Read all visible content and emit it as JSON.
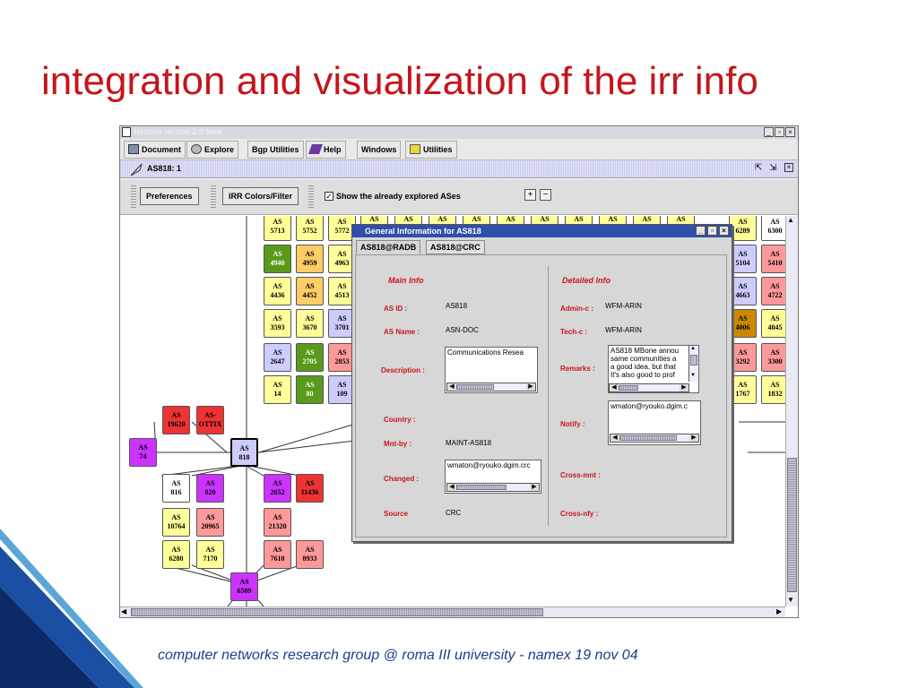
{
  "slide": {
    "title": "integration and visualization of the irr info",
    "footer": "computer networks research group @ roma III university - namex 19 nov 04"
  },
  "window": {
    "title": "Hermes version 2.0 beta"
  },
  "menubar": [
    {
      "label": "Document",
      "icon": "document-icon"
    },
    {
      "label": "Explore",
      "icon": "explore-icon"
    },
    {
      "label": "Bgp Utilities",
      "icon": ""
    },
    {
      "label": "Help",
      "icon": "help-icon"
    },
    {
      "label": "Windows",
      "icon": ""
    },
    {
      "label": "Utilities",
      "icon": "utilities-icon"
    }
  ],
  "frame": {
    "title": "AS818: 1"
  },
  "toolbar": {
    "preferences": "Preferences",
    "irr_colors": "IRR Colors/Filter",
    "show_explored": "Show the already explored ASes",
    "show_explored_checked": true
  },
  "graph": {
    "nodes": [
      {
        "label": "AS 5713",
        "color": "#ffff99"
      },
      {
        "label": "AS 5752",
        "color": "#ffff99"
      },
      {
        "label": "AS 5772",
        "color": "#ffff99"
      },
      {
        "label": "AS 4940",
        "color": "#5a9a1a"
      },
      {
        "label": "AS 4959",
        "color": "#ffcc66"
      },
      {
        "label": "AS 4963",
        "color": "#ffff99"
      },
      {
        "label": "AS 4436",
        "color": "#ffff99"
      },
      {
        "label": "AS 4452",
        "color": "#ffcc66"
      },
      {
        "label": "AS 4513",
        "color": "#ffff99"
      },
      {
        "label": "AS 3593",
        "color": "#ffff99"
      },
      {
        "label": "AS 3670",
        "color": "#ffff99"
      },
      {
        "label": "AS 3701",
        "color": "#ccccff"
      },
      {
        "label": "AS 2647",
        "color": "#ccccff"
      },
      {
        "label": "AS 2705",
        "color": "#5a9a1a"
      },
      {
        "label": "AS 2853",
        "color": "#ff9999"
      },
      {
        "label": "AS 14",
        "color": "#ffff99"
      },
      {
        "label": "AS 80",
        "color": "#5a9a1a"
      },
      {
        "label": "AS 109",
        "color": "#ccccff"
      },
      {
        "label": "AS 19620",
        "color": "#ee3333"
      },
      {
        "label": "AS- OTTIX",
        "color": "#ee3333"
      },
      {
        "label": "AS 74",
        "color": "#cc33ff"
      },
      {
        "label": "AS 818",
        "color": "#ccccff"
      },
      {
        "label": "AS 816",
        "color": "#ffffff"
      },
      {
        "label": "AS 820",
        "color": "#cc33ff"
      },
      {
        "label": "AS 2652",
        "color": "#cc33ff"
      },
      {
        "label": "AS 11436",
        "color": "#ee3333"
      },
      {
        "label": "AS 10764",
        "color": "#ffff99"
      },
      {
        "label": "AS 20965",
        "color": "#ff9999"
      },
      {
        "label": "AS 21320",
        "color": "#ff9999"
      },
      {
        "label": "AS 6280",
        "color": "#ffff99"
      },
      {
        "label": "AS 7170",
        "color": "#ffff99"
      },
      {
        "label": "AS 7610",
        "color": "#ff9999"
      },
      {
        "label": "AS 8933",
        "color": "#ff9999"
      },
      {
        "label": "AS 6509",
        "color": "#cc33ff"
      },
      {
        "label": "AS 6289",
        "color": "#ffff99"
      },
      {
        "label": "AS 6300",
        "color": "#ffffff"
      },
      {
        "label": "AS 5104",
        "color": "#ccccff"
      },
      {
        "label": "AS 5410",
        "color": "#ff9999"
      },
      {
        "label": "AS 4663",
        "color": "#ccccff"
      },
      {
        "label": "AS 4722",
        "color": "#ff9999"
      },
      {
        "label": "AS 4006",
        "color": "#cc8800"
      },
      {
        "label": "AS 4045",
        "color": "#ffff99"
      },
      {
        "label": "AS 3292",
        "color": "#ff9999"
      },
      {
        "label": "AS 3300",
        "color": "#ff9999"
      },
      {
        "label": "AS 1767",
        "color": "#ffff99"
      },
      {
        "label": "AS 1832",
        "color": "#ffff99"
      }
    ],
    "top_row_partial": [
      "AS",
      "AS",
      "AS",
      "AS",
      "AS",
      "AS",
      "AS",
      "AS",
      "AS",
      "AS"
    ]
  },
  "dialog": {
    "title": "General Information for AS818",
    "tabs": [
      "AS818@RADB",
      "AS818@CRC"
    ],
    "main_info": "Main Info",
    "detailed_info": "Detailed Info",
    "as_id_label": "AS ID :",
    "as_id": "AS818",
    "as_name_label": "AS Name :",
    "as_name": "ASN-DOC",
    "description_label": "Description :",
    "description": "Communications Resea",
    "country_label": "Country :",
    "mnt_by_label": "Mnt-by :",
    "mnt_by": "MAINT-AS818",
    "changed_label": "Changed :",
    "changed": "wmaton@ryouko.dgim.crc",
    "source_label": "Source",
    "source": "CRC",
    "admin_c_label": "Admin-c :",
    "admin_c": "WFM-ARIN",
    "tech_c_label": "Tech-c :",
    "tech_c": "WFM-ARIN",
    "remarks_label": "Remarks :",
    "remarks": [
      "AS818 MBone annou",
      "same communities a",
      "a good idea, but that",
      "It's also good to prof"
    ],
    "notify_label": "Notify :",
    "notify": "wmaton@ryouko.dgim.c",
    "cross_mnt_label": "Cross-mnt :",
    "cross_nfy_label": "Cross-nfy :"
  }
}
